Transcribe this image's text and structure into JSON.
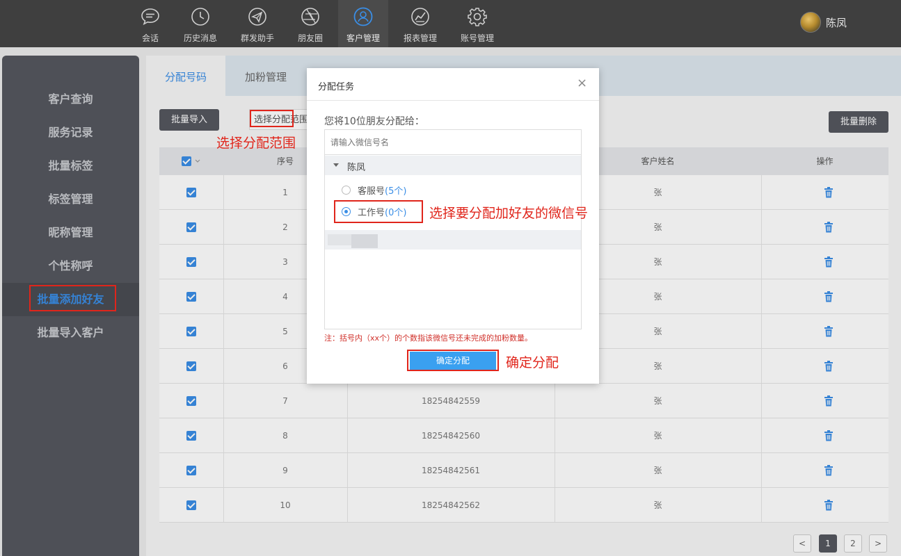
{
  "topnav": {
    "items": [
      {
        "label": "会话",
        "icon": "chat-icon"
      },
      {
        "label": "历史消息",
        "icon": "clock-icon"
      },
      {
        "label": "群发助手",
        "icon": "send-icon"
      },
      {
        "label": "朋友圈",
        "icon": "aperture-icon"
      },
      {
        "label": "客户管理",
        "icon": "customer-icon"
      },
      {
        "label": "报表管理",
        "icon": "chart-icon"
      },
      {
        "label": "账号管理",
        "icon": "gear-icon"
      }
    ],
    "active": "客户管理",
    "user_name": "陈凤"
  },
  "sidebar": {
    "items": [
      "客户查询",
      "服务记录",
      "批量标签",
      "标签管理",
      "昵称管理",
      "个性称呼",
      "批量添加好友",
      "批量导入客户"
    ],
    "active": "批量添加好友"
  },
  "tabs": [
    "分配号码",
    "加粉管理"
  ],
  "toolbar": {
    "import_label": "批量导入",
    "select_range": "选择分配范围",
    "delete_label": "批量删除"
  },
  "table": {
    "headers": {
      "seq": "序号",
      "name": "客户姓名",
      "ops": "操作"
    },
    "rows": [
      {
        "seq": "1",
        "phone": "",
        "name": "张"
      },
      {
        "seq": "2",
        "phone": "",
        "name": "张"
      },
      {
        "seq": "3",
        "phone": "",
        "name": "张"
      },
      {
        "seq": "4",
        "phone": "",
        "name": "张"
      },
      {
        "seq": "5",
        "phone": "",
        "name": "张"
      },
      {
        "seq": "6",
        "phone": "",
        "name": "张"
      },
      {
        "seq": "7",
        "phone": "18254842559",
        "name": "张"
      },
      {
        "seq": "8",
        "phone": "18254842560",
        "name": "张"
      },
      {
        "seq": "9",
        "phone": "18254842561",
        "name": "张"
      },
      {
        "seq": "10",
        "phone": "18254842562",
        "name": "张"
      }
    ]
  },
  "pagination": {
    "prev": "<",
    "pages": [
      "1",
      "2"
    ],
    "next": ">",
    "current": "1"
  },
  "dialog": {
    "title": "分配任务",
    "close": "×",
    "prompt": "您将10位朋友分配给：",
    "search_placeholder": "请输入微信号名",
    "tree_root": "陈凤",
    "options": [
      {
        "label": "客服号",
        "count": "(5个)",
        "selected": false
      },
      {
        "label": "工作号",
        "count": "(0个)",
        "selected": true
      }
    ],
    "note": "注：括号内（xx个）的个数指该微信号还未完成的加粉数量。",
    "confirm_label": "确定分配"
  },
  "annotations": {
    "select_range": "选择分配范围",
    "select_account": "选择要分配加好友的微信号",
    "confirm": "确定分配"
  },
  "colors": {
    "accent": "#3a8ee6",
    "annotation": "#e0251b",
    "topbar": "#3f3f3f",
    "sidebar": "#55575f"
  }
}
